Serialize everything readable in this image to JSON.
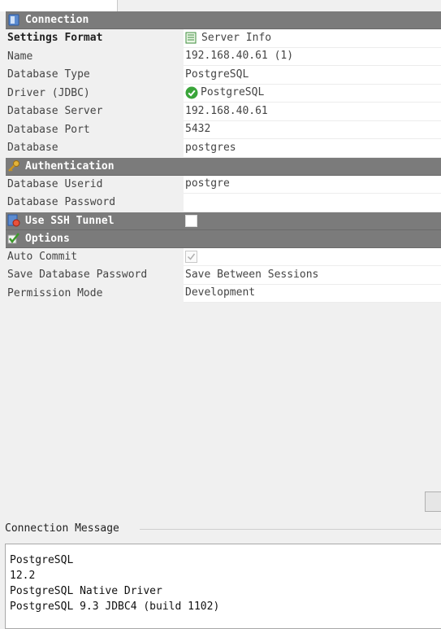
{
  "sections": {
    "connection": {
      "title": "Connection"
    },
    "authentication": {
      "title": "Authentication"
    },
    "ssh": {
      "title": "Use SSH Tunnel",
      "checked": false
    },
    "options": {
      "title": "Options"
    }
  },
  "connection_rows": [
    {
      "label": "Settings Format",
      "value": "Server Info",
      "bold": true,
      "icon": "server-info-icon"
    },
    {
      "label": "Name",
      "value": "192.168.40.61 (1)"
    },
    {
      "label": "Database Type",
      "value": "PostgreSQL"
    },
    {
      "label": "Driver (JDBC)",
      "value": "PostgreSQL",
      "icon": "check-ok-icon"
    },
    {
      "label": "Database Server",
      "value": "192.168.40.61"
    },
    {
      "label": "Database Port",
      "value": "5432"
    },
    {
      "label": "Database",
      "value": "postgres"
    }
  ],
  "auth_rows": [
    {
      "label": "Database Userid",
      "value": "postgre"
    },
    {
      "label": "Database Password",
      "value": ""
    }
  ],
  "options_rows": [
    {
      "label": "Auto Commit",
      "checked": true
    },
    {
      "label": "Save Database Password",
      "value": "Save Between Sessions"
    },
    {
      "label": "Permission Mode",
      "value": "Development"
    }
  ],
  "connection_message": {
    "title": "Connection Message",
    "lines": [
      "PostgreSQL",
      "12.2",
      "PostgreSQL Native Driver",
      "PostgreSQL 9.3 JDBC4 (build 1102)"
    ]
  },
  "colors": {
    "section_bg": "#7b7b7b",
    "ok_green": "#3aa53a"
  }
}
